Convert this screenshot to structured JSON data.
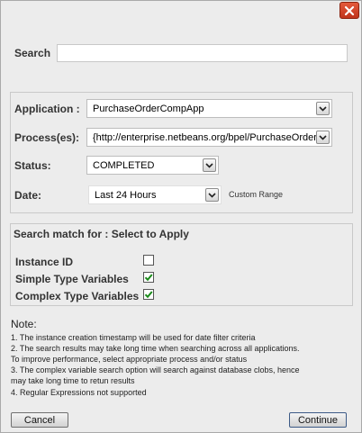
{
  "search": {
    "label": "Search",
    "value": "",
    "placeholder": ""
  },
  "filters": {
    "application": {
      "label": "Application :",
      "selected": "PurchaseOrderCompApp"
    },
    "processes": {
      "label": "Process(es):",
      "selected": "{http://enterprise.netbeans.org/bpel/PurchaseOrderService}"
    },
    "status": {
      "label": "Status:",
      "selected": "COMPLETED"
    },
    "date": {
      "label": "Date:",
      "selected": "Last 24 Hours",
      "custom_range": "Custom Range"
    }
  },
  "match": {
    "title": "Search match for : Select to Apply",
    "instance_id": {
      "label": "Instance ID",
      "checked": false
    },
    "simple_type": {
      "label": "Simple Type Variables",
      "checked": true
    },
    "complex_type": {
      "label": "Complex Type Variables",
      "checked": true
    }
  },
  "note": {
    "title": "Note:",
    "lines": [
      "1. The instance creation timestamp will be used for date filter criteria",
      "2. The search results may take long time when searching across all applications.",
      "To improve performance, select appropriate process and/or status",
      "3. The complex variable search option will search against database clobs, hence",
      "may take long time to retun results",
      "4. Regular Expressions not supported"
    ]
  },
  "buttons": {
    "cancel": "Cancel",
    "continue": "Continue"
  },
  "icons": {
    "close": "close-icon",
    "dropdown": "chevron-down-icon",
    "check": "checkmark-icon"
  },
  "colors": {
    "close_button": "#d2472b",
    "checkmark": "#1a8a1a"
  }
}
